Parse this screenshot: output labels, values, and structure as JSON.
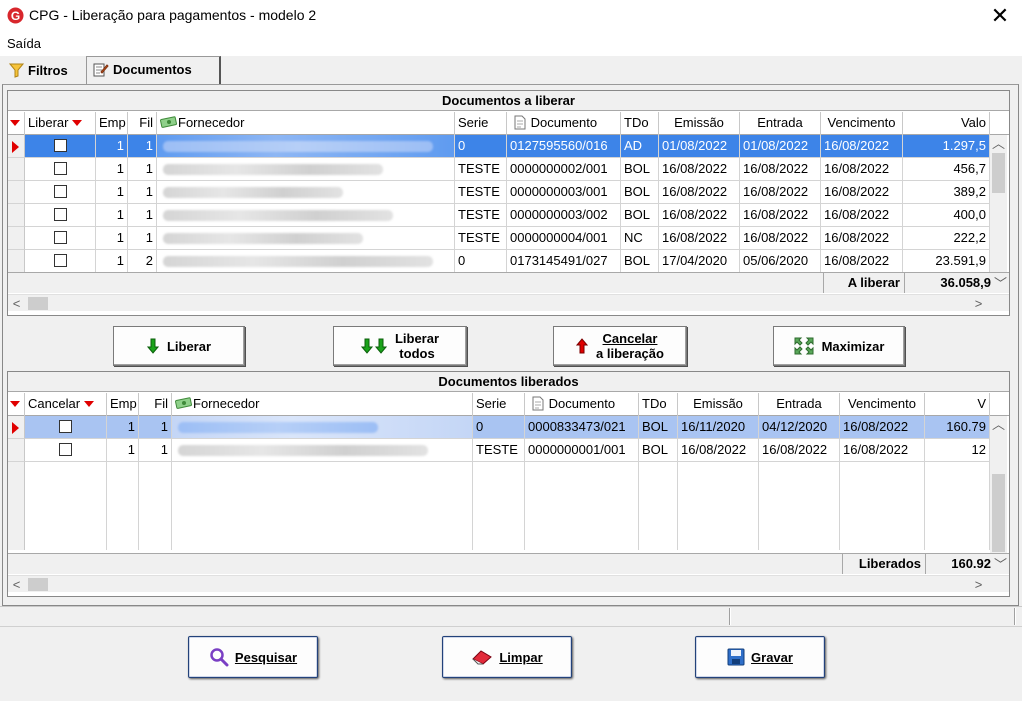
{
  "window": {
    "title": "CPG - Liberação para pagamentos - modelo 2",
    "close": "✕"
  },
  "menu": {
    "saida": "Saída"
  },
  "tabs": [
    {
      "label": "Filtros"
    },
    {
      "label": "Documentos"
    }
  ],
  "grid1": {
    "caption": "Documentos a liberar",
    "headers": {
      "check": "Liberar",
      "emp": "Emp",
      "fil": "Fil",
      "fornecedor": "Fornecedor",
      "serie": "Serie",
      "documento": "Documento",
      "tdo": "TDo",
      "emissao": "Emissão",
      "entrada": "Entrada",
      "vencimento": "Vencimento",
      "valor": "Valo"
    },
    "rows": [
      {
        "emp": "1",
        "fil": "1",
        "serie": "0",
        "documento": "0127595560/016",
        "tdo": "AD",
        "emissao": "01/08/2022",
        "entrada": "01/08/2022",
        "vencimento": "16/08/2022",
        "valor": "1.297,5"
      },
      {
        "emp": "1",
        "fil": "1",
        "serie": "TESTE",
        "documento": "0000000002/001",
        "tdo": "BOL",
        "emissao": "16/08/2022",
        "entrada": "16/08/2022",
        "vencimento": "16/08/2022",
        "valor": "456,7"
      },
      {
        "emp": "1",
        "fil": "1",
        "serie": "TESTE",
        "documento": "0000000003/001",
        "tdo": "BOL",
        "emissao": "16/08/2022",
        "entrada": "16/08/2022",
        "vencimento": "16/08/2022",
        "valor": "389,2"
      },
      {
        "emp": "1",
        "fil": "1",
        "serie": "TESTE",
        "documento": "0000000003/002",
        "tdo": "BOL",
        "emissao": "16/08/2022",
        "entrada": "16/08/2022",
        "vencimento": "16/08/2022",
        "valor": "400,0"
      },
      {
        "emp": "1",
        "fil": "1",
        "serie": "TESTE",
        "documento": "0000000004/001",
        "tdo": "NC",
        "emissao": "16/08/2022",
        "entrada": "16/08/2022",
        "vencimento": "16/08/2022",
        "valor": "222,2"
      },
      {
        "emp": "1",
        "fil": "2",
        "serie": "0",
        "documento": "0173145491/027",
        "tdo": "BOL",
        "emissao": "17/04/2020",
        "entrada": "05/06/2020",
        "vencimento": "16/08/2022",
        "valor": "23.591,9"
      }
    ],
    "total_label": "A liberar",
    "total_value": "36.058,9"
  },
  "actions": {
    "liberar": "Liberar",
    "liberar_todos_1": "Liberar",
    "liberar_todos_2": "todos",
    "cancelar_1": "Cancelar",
    "cancelar_2": "a liberação",
    "maximizar": "Maximizar"
  },
  "grid2": {
    "caption": "Documentos liberados",
    "headers": {
      "check": "Cancelar",
      "emp": "Emp",
      "fil": "Fil",
      "fornecedor": "Fornecedor",
      "serie": "Serie",
      "documento": "Documento",
      "tdo": "TDo",
      "emissao": "Emissão",
      "entrada": "Entrada",
      "vencimento": "Vencimento",
      "valor": "V"
    },
    "rows": [
      {
        "emp": "1",
        "fil": "1",
        "serie": "0",
        "documento": "0000833473/021",
        "tdo": "BOL",
        "emissao": "16/11/2020",
        "entrada": "04/12/2020",
        "vencimento": "16/08/2022",
        "valor": "160.79"
      },
      {
        "emp": "1",
        "fil": "1",
        "serie": "TESTE",
        "documento": "0000000001/001",
        "tdo": "BOL",
        "emissao": "16/08/2022",
        "entrada": "16/08/2022",
        "vencimento": "16/08/2022",
        "valor": "12"
      }
    ],
    "total_label": "Liberados",
    "total_value": "160.92"
  },
  "bottom": {
    "pesquisar": "Pesquisar",
    "limpar": "Limpar",
    "gravar": "Gravar"
  },
  "colors": {
    "selection": "#3d84e8",
    "selection_light": "#a9c4f2",
    "accent_red": "#e00000",
    "arrow_green": "#1aa31a"
  }
}
